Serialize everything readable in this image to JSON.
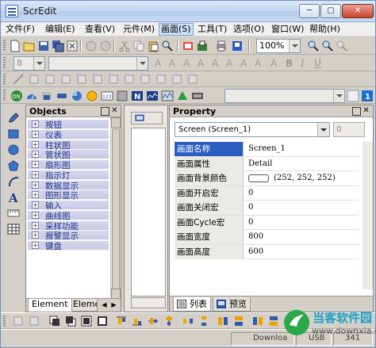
{
  "window": {
    "title": "ScrEdit",
    "controls": {
      "minimize": "─",
      "maximize": "▢",
      "close": "✕"
    }
  },
  "menubar": {
    "items": [
      {
        "label": "文件(F)"
      },
      {
        "label": "编辑(E)"
      },
      {
        "label": "查看(V)"
      },
      {
        "label": "元件(M)"
      },
      {
        "label": "画面(S)"
      },
      {
        "label": "工具(T)"
      },
      {
        "label": "选项(O)"
      },
      {
        "label": "窗口(W)"
      },
      {
        "label": "帮助(H)"
      }
    ],
    "active_index": 4
  },
  "toolbar": {
    "zoom_value": "100%",
    "font_size_value": "8",
    "font_name_value": ""
  },
  "objects_pane": {
    "title": "Objects",
    "items": [
      {
        "label": "按钮"
      },
      {
        "label": "仪表"
      },
      {
        "label": "柱状图"
      },
      {
        "label": "管状图"
      },
      {
        "label": "扇形图"
      },
      {
        "label": "指示灯"
      },
      {
        "label": "数据显示"
      },
      {
        "label": "图形显示"
      },
      {
        "label": "输入"
      },
      {
        "label": "曲线图"
      },
      {
        "label": "采样功能"
      },
      {
        "label": "报警显示"
      },
      {
        "label": "键盘"
      }
    ],
    "tabs": [
      {
        "label": "Element"
      },
      {
        "label": "Eleme"
      }
    ]
  },
  "property_pane": {
    "title": "Property",
    "selector_value": "Screen (Screen_1)",
    "number_value": "0",
    "rows": [
      {
        "key": "画面名称",
        "value": "Screen_1"
      },
      {
        "key": "画面属性",
        "value": "Detail"
      },
      {
        "key": "画面背景颜色",
        "value": "(252, 252, 252)"
      },
      {
        "key": "画面开启宏",
        "value": "0"
      },
      {
        "key": "画面关闭宏",
        "value": "0"
      },
      {
        "key": "画面Cycle宏",
        "value": "0"
      },
      {
        "key": "画面宽度",
        "value": "800"
      },
      {
        "key": "画面高度",
        "value": "600"
      }
    ],
    "tabs": [
      {
        "label": "列表"
      },
      {
        "label": "预览"
      }
    ]
  },
  "statusbar": {
    "text_left": "Downloa",
    "text_mid": "USB",
    "text_right": "341"
  },
  "watermark": {
    "title": "当客软件园",
    "url": "www.downxia.com"
  },
  "colors": {
    "titlebar": "#c3d7ef",
    "selection": "#2b5ec1",
    "object_item": "#c8c9e4",
    "object_label": "#1b2f8a",
    "background_swatch": "#fcfcfc"
  }
}
